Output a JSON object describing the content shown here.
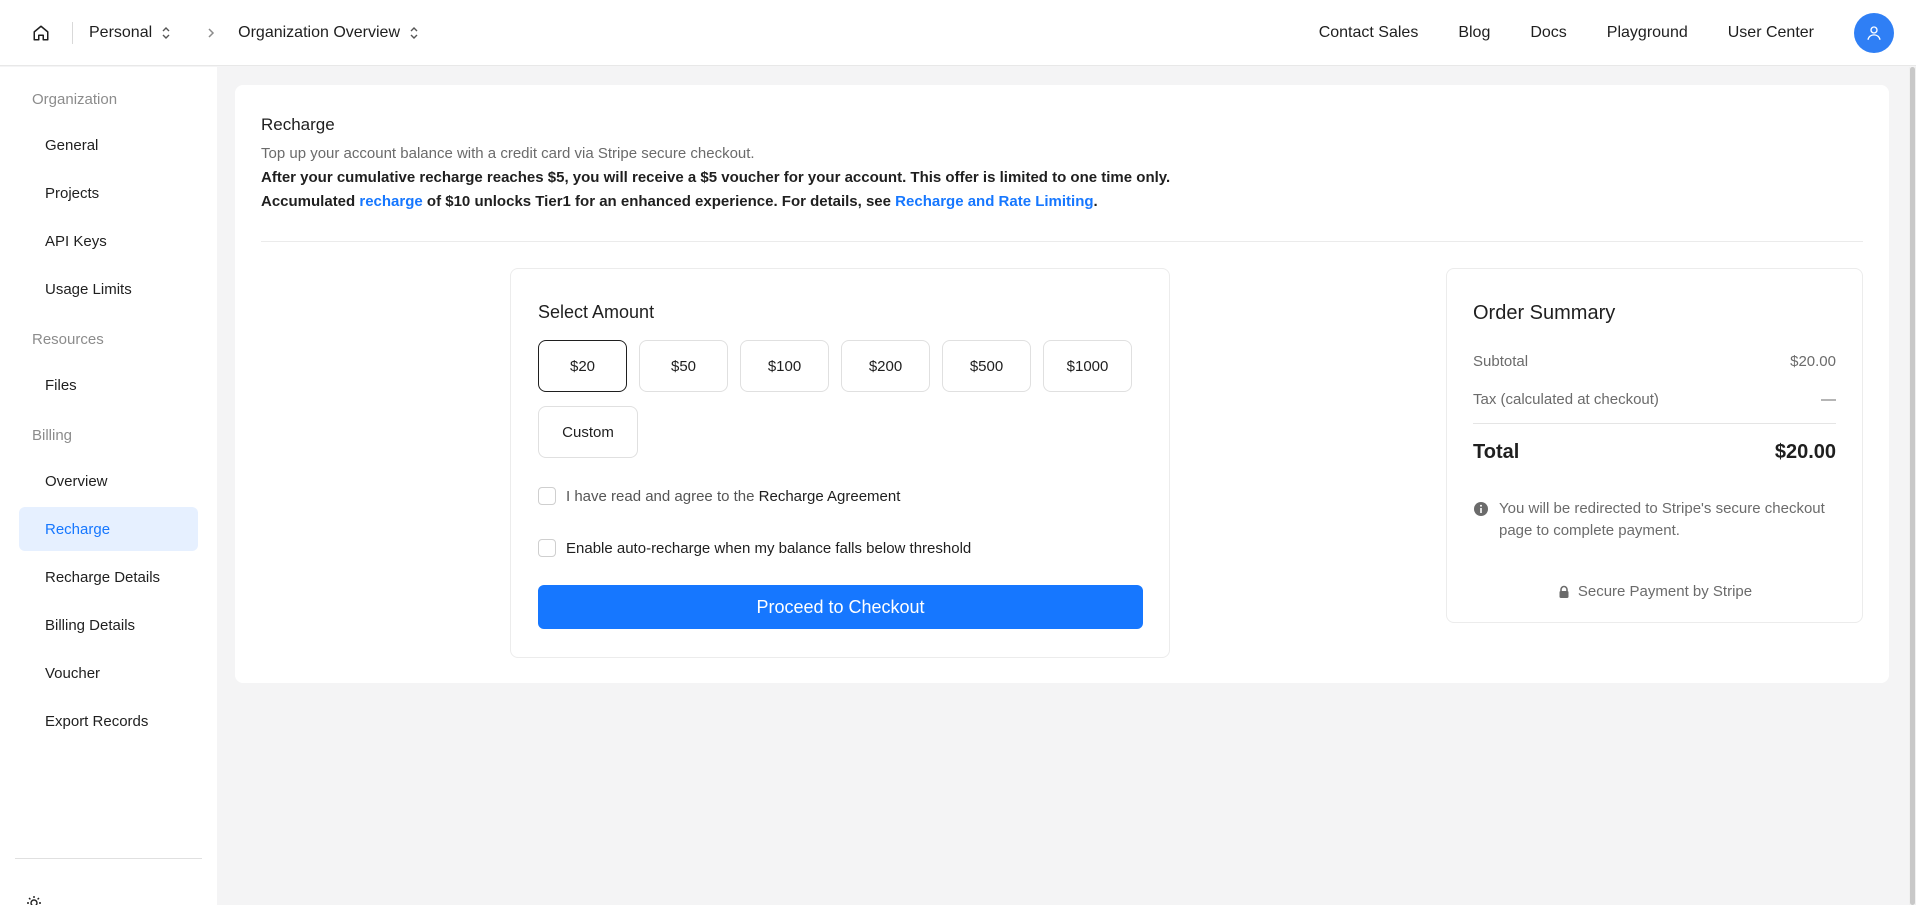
{
  "topbar": {
    "workspace": "Personal",
    "page": "Organization Overview",
    "nav": [
      "Contact Sales",
      "Blog",
      "Docs",
      "Playground",
      "User Center"
    ]
  },
  "sidebar": {
    "sections": [
      {
        "title": "Organization",
        "items": [
          "General",
          "Projects",
          "API Keys",
          "Usage Limits"
        ]
      },
      {
        "title": "Resources",
        "items": [
          "Files"
        ]
      },
      {
        "title": "Billing",
        "items": [
          "Overview",
          "Recharge",
          "Recharge Details",
          "Billing Details",
          "Voucher",
          "Export Records"
        ]
      }
    ],
    "active_item": "Recharge"
  },
  "recharge": {
    "title": "Recharge",
    "subtitle": "Top up your account balance with a credit card via Stripe secure checkout.",
    "notice": "After your cumulative recharge reaches $5, you will receive a $5 voucher for your account. This offer is limited to one time only.",
    "tier_prefix": "Accumulated",
    "tier_link": "recharge",
    "tier_middle": "of $10 unlocks Tier1 for an enhanced experience. For details, see",
    "tier_doc_link": "Recharge and Rate Limiting",
    "tier_suffix": "."
  },
  "amount": {
    "title": "Select Amount",
    "options": [
      "$20",
      "$50",
      "$100",
      "$200",
      "$500",
      "$1000"
    ],
    "custom": "Custom",
    "selected": "$20",
    "agree_text": "I have read and agree to the",
    "agree_link": "Recharge Agreement",
    "auto_recharge": "Enable auto-recharge when my balance falls below threshold",
    "checkout": "Proceed to Checkout"
  },
  "summary": {
    "title": "Order Summary",
    "subtotal_label": "Subtotal",
    "subtotal_value": "$20.00",
    "tax_label": "Tax (calculated at checkout)",
    "tax_value": "—",
    "total_label": "Total",
    "total_value": "$20.00",
    "note": "You will be redirected to Stripe's secure checkout page to complete payment.",
    "secure": "Secure Payment by Stripe"
  },
  "colors": {
    "accent": "#1677ff",
    "avatar": "#2f7ff5",
    "active_bg": "#e6f0ff"
  }
}
